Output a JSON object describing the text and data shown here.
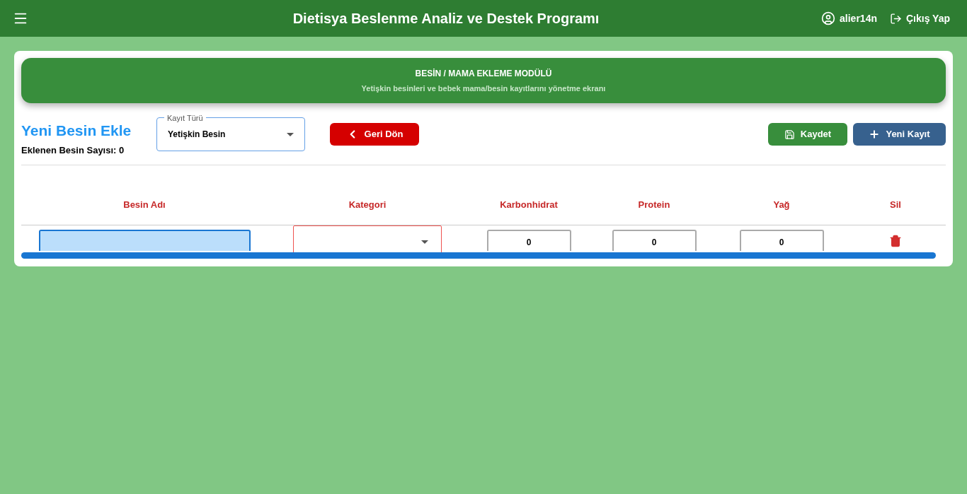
{
  "header": {
    "title": "Dietisya Beslenme Analiz ve Destek Programı",
    "user": "alier14n",
    "logout": "Çıkış Yap"
  },
  "banner": {
    "title": "BESİN / MAMA EKLEME MODÜLÜ",
    "subtitle": "Yetişkin besinleri ve bebek mama/besin kayıtlarını yönetme ekranı"
  },
  "form": {
    "heading": "Yeni Besin Ekle",
    "count": "Eklenen Besin Sayısı: 0",
    "record_type": {
      "label": "Kayıt Türü",
      "value": "Yetişkin Besin"
    },
    "back_button": "Geri Dön",
    "save_button": "Kaydet",
    "new_button": "Yeni Kayıt"
  },
  "table": {
    "columns": [
      "Besin Adı",
      "Kategori",
      "Karbonhidrat",
      "Protein",
      "Yağ",
      "Sil"
    ],
    "rows": [
      {
        "name": {
          "focused": true
        },
        "category": {
          "error": true
        },
        "carbs": "0",
        "protein": "0",
        "fat": "0"
      }
    ]
  }
}
